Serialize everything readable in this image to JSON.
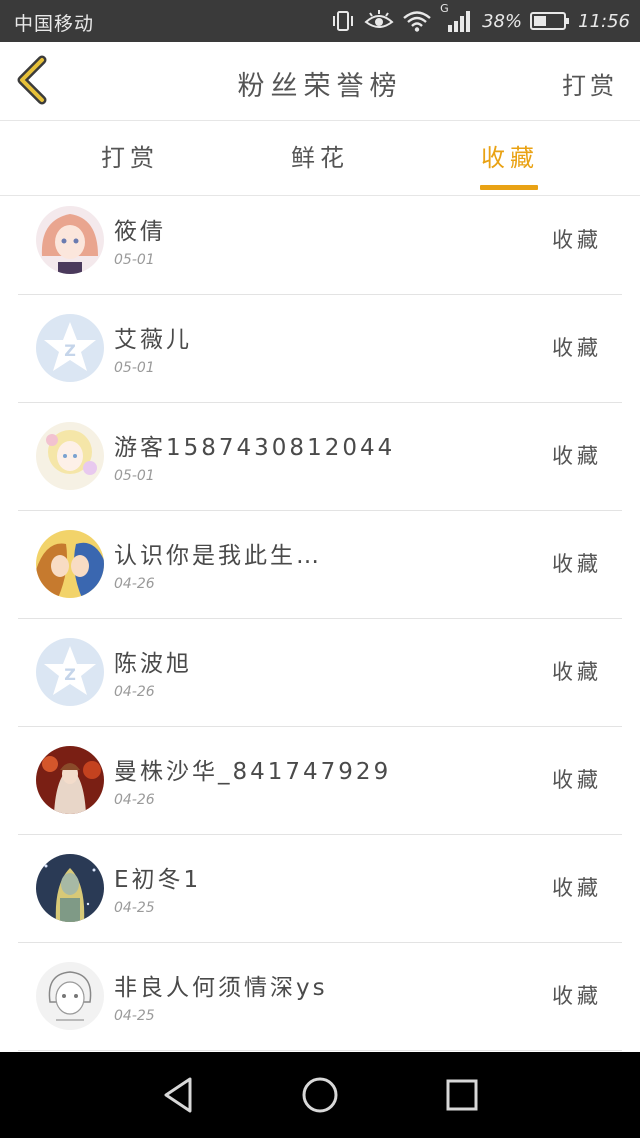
{
  "status_bar": {
    "carrier": "中国移动",
    "network": "G",
    "battery": "38%",
    "time": "11:56"
  },
  "header": {
    "title": "粉丝荣誉榜",
    "action_label": "打赏"
  },
  "tabs": [
    {
      "label": "打赏"
    },
    {
      "label": "鲜花"
    },
    {
      "label": "收藏",
      "active": true
    }
  ],
  "fans": [
    {
      "name": "筱倩",
      "date": "05-01",
      "action": "收藏",
      "avatar": "anime-girl-pink-avatar"
    },
    {
      "name": "艾薇儿",
      "date": "05-01",
      "action": "收藏",
      "avatar": "default-qq-avatar"
    },
    {
      "name": "游客1587430812044",
      "date": "05-01",
      "action": "收藏",
      "avatar": "anime-girl-light-avatar"
    },
    {
      "name": "认识你是我此生…",
      "date": "04-26",
      "action": "收藏",
      "avatar": "anime-couple-avatar"
    },
    {
      "name": "陈波旭",
      "date": "04-26",
      "action": "收藏",
      "avatar": "default-qq-avatar"
    },
    {
      "name": "曼株沙华_841747929",
      "date": "04-26",
      "action": "收藏",
      "avatar": "anime-girl-red-avatar"
    },
    {
      "name": "E初冬1",
      "date": "04-25",
      "action": "收藏",
      "avatar": "anime-night-avatar"
    },
    {
      "name": "非良人何须情深ys",
      "date": "04-25",
      "action": "收藏",
      "avatar": "sketch-boy-avatar"
    }
  ],
  "colors": {
    "accent": "#e9a214",
    "status_bar_bg": "#3a3a3a",
    "nav_bar_bg": "#000000",
    "divider": "#e3e3e3"
  }
}
